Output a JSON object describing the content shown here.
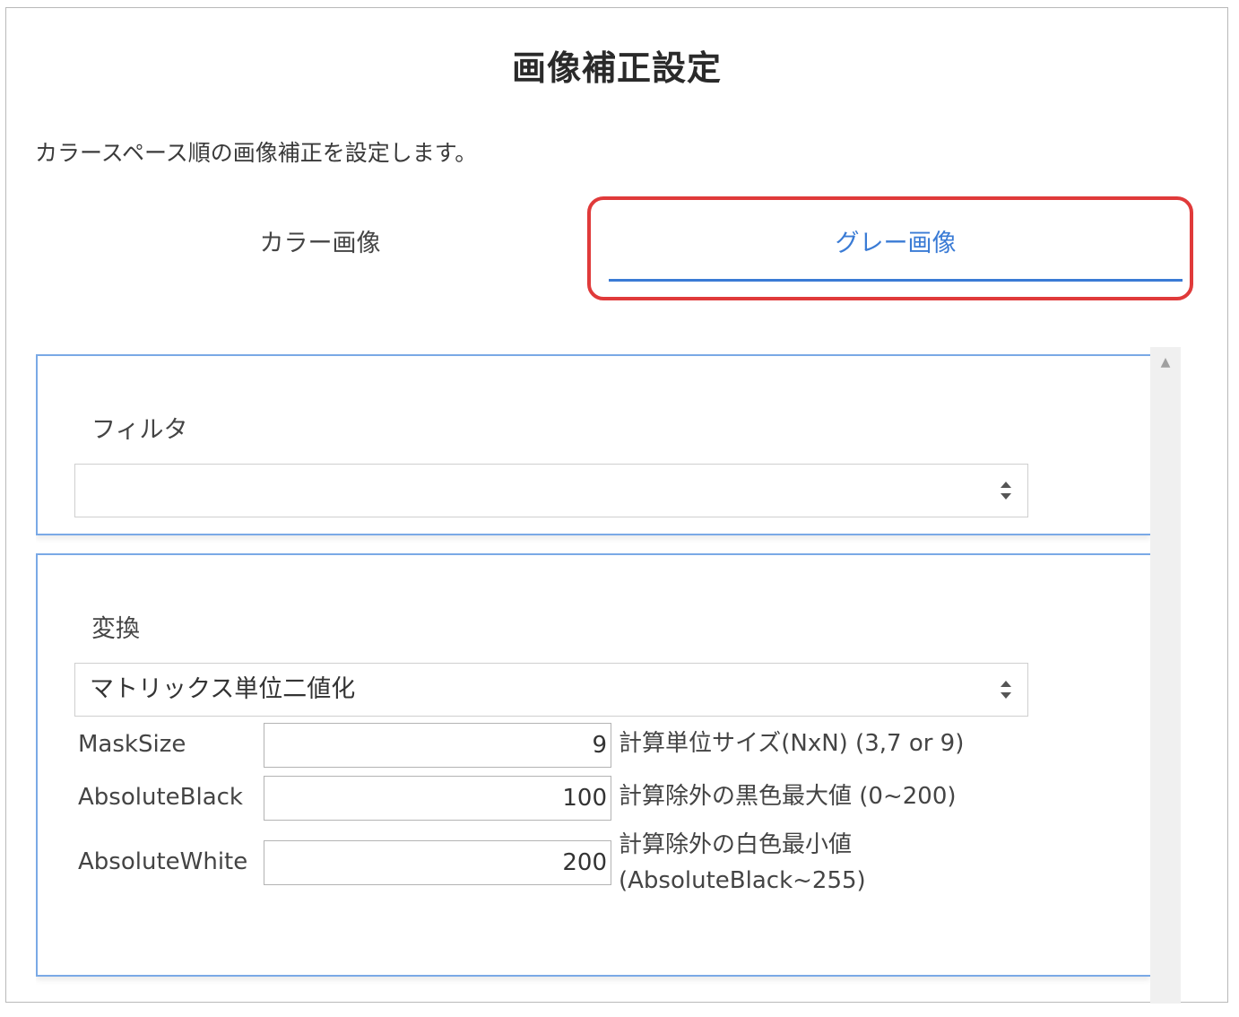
{
  "dialog": {
    "title": "画像補正設定",
    "description": "カラースペース順の画像補正を設定します。"
  },
  "tabs": [
    {
      "label": "カラー画像",
      "active": false
    },
    {
      "label": "グレー画像",
      "active": true
    }
  ],
  "filter_section": {
    "label": "フィルタ",
    "selected": ""
  },
  "convert_section": {
    "label": "変換",
    "selected": "マトリックス単位二値化",
    "params": [
      {
        "name": "MaskSize",
        "value": "9",
        "description_line1": "計算単位サイズ(NxN) (3,7 or 9)",
        "description_line2": ""
      },
      {
        "name": "AbsoluteBlack",
        "value": "100",
        "description_line1": "計算除外の黒色最大値 (0~200)",
        "description_line2": ""
      },
      {
        "name": "AbsoluteWhite",
        "value": "200",
        "description_line1": "計算除外の白色最小値",
        "description_line2": "(AbsoluteBlack~255)"
      }
    ]
  },
  "colors": {
    "accent": "#3a7bd5",
    "highlight": "#e03a3a",
    "panel_border": "#7aa9e6"
  }
}
